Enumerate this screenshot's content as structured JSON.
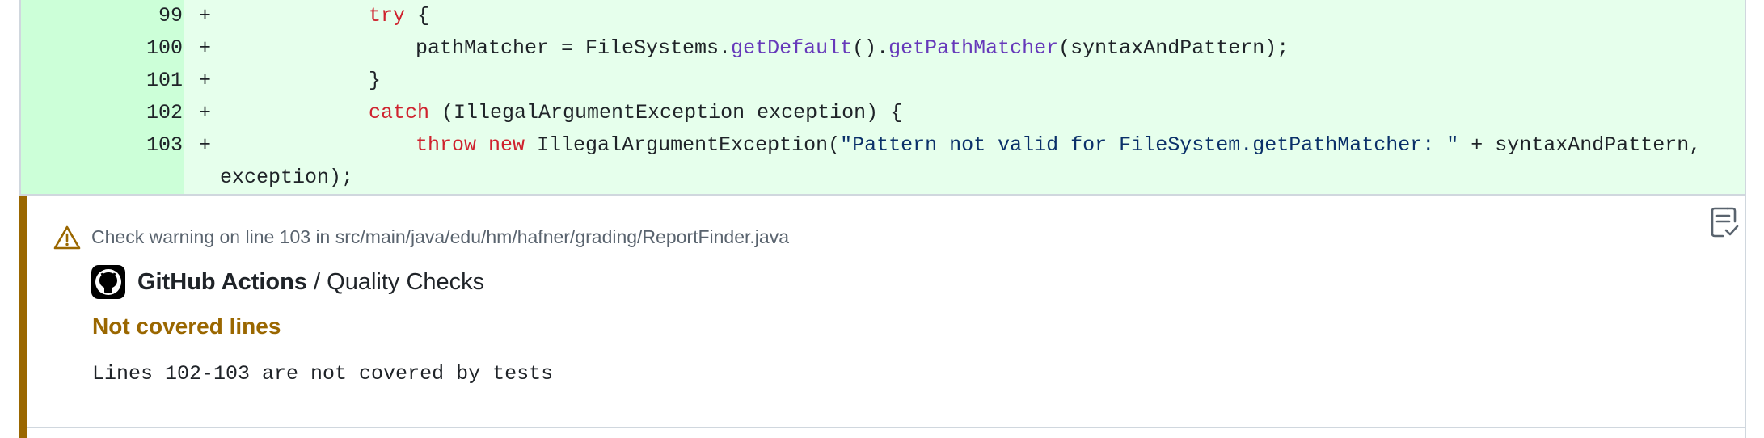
{
  "diff": {
    "lines": [
      {
        "num": "99",
        "sign": "+"
      },
      {
        "num": "100",
        "sign": "+"
      },
      {
        "num": "101",
        "sign": "+"
      },
      {
        "num": "102",
        "sign": "+"
      },
      {
        "num": "103",
        "sign": "+"
      }
    ],
    "code": {
      "l99_kw": "try",
      "l99_rest": " {",
      "l100_a": "pathMatcher = FileSystems.",
      "l100_fn1": "getDefault",
      "l100_b": "().",
      "l100_fn2": "getPathMatcher",
      "l100_c": "(syntaxAndPattern);",
      "l101": "}",
      "l102_kw": "catch",
      "l102_rest": " (IllegalArgumentException exception) {",
      "l103_kw1": "throw",
      "l103_kw2": "new",
      "l103_a": " IllegalArgumentException(",
      "l103_str": "\"Pattern not valid for FileSystem.getPathMatcher: \"",
      "l103_b": " + syntaxAndPattern,",
      "l103_wrap": "exception);"
    }
  },
  "annotation": {
    "warning_text": "Check warning on line 103 in src/main/java/edu/hm/hafner/grading/ReportFinder.java",
    "app_name": "GitHub Actions",
    "separator": " / ",
    "check_name": "Quality Checks",
    "title": "Not covered lines",
    "message": "Lines 102-103 are not covered by tests",
    "icons": [
      "alert-icon",
      "report-icon",
      "github-logo-icon"
    ],
    "colors": {
      "warning": "#9a6700",
      "added_bg": "#e6ffec",
      "added_gutter": "#ccffd8"
    }
  }
}
